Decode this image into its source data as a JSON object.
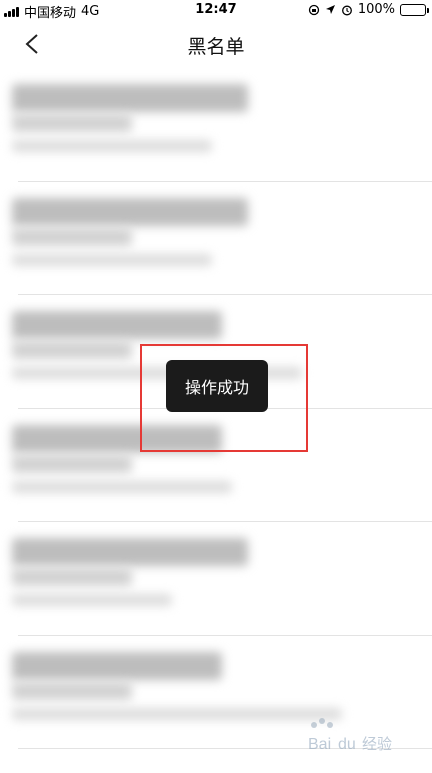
{
  "status_bar": {
    "carrier": "中国移动",
    "network": "4G",
    "time": "12:47",
    "battery": "100%",
    "icons": [
      "signal-icon",
      "lock-rotation-icon",
      "location-icon",
      "alarm-icon",
      "battery-icon"
    ]
  },
  "nav": {
    "title": "黑名单",
    "back_icon": "chevron-left-icon"
  },
  "list": {
    "rows": [
      {
        "name": "",
        "detail": ""
      },
      {
        "name": "",
        "detail": ""
      },
      {
        "name": "",
        "detail": ""
      },
      {
        "name": "",
        "detail": ""
      },
      {
        "name": "",
        "detail": ""
      },
      {
        "name": "",
        "detail": ""
      }
    ]
  },
  "toast": {
    "text": "操作成功"
  },
  "watermark": {
    "brand": "Bai du 经验"
  },
  "colors": {
    "highlight": "#e53935",
    "toast_bg": "#1b1b1b"
  }
}
